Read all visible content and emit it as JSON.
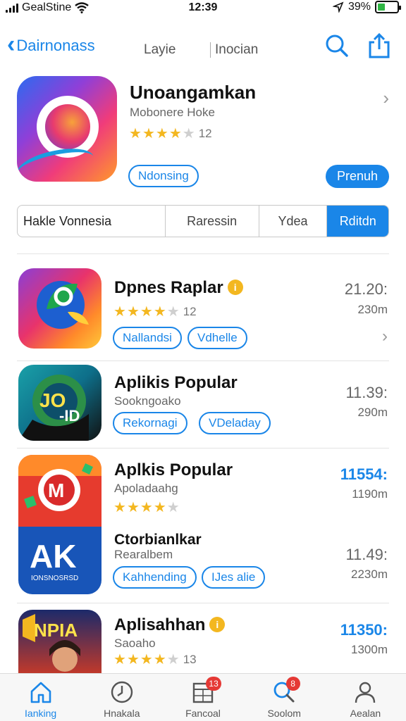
{
  "status": {
    "carrier": "GealStine",
    "time": "12:39",
    "battery": "39%",
    "battery_level": 0.39
  },
  "nav": {
    "back_label": "Dairnonass",
    "tab1": "Layie",
    "tab2": "Inocian"
  },
  "hero": {
    "title": "Unoangamkan",
    "subtitle": "Mobonere Hoke",
    "stars": 4,
    "rating_count": "12",
    "tag": "Ndonsing",
    "action": "Prenuh"
  },
  "segments": [
    "Hakle Vonnesia",
    "Raressin",
    "Ydea",
    "Rditdn"
  ],
  "apps": [
    {
      "name": "Dpnes Raplar",
      "sub": "",
      "stars": 4,
      "rating_count": "12",
      "tags": [
        "Nallandsi",
        "Vdhelle"
      ],
      "time": "21.20:",
      "size": "230m",
      "badge": true
    },
    {
      "name": "Aplikis Popular",
      "sub": "Sookngoako",
      "stars": 0,
      "rating_count": "",
      "tags": [
        "Rekornagi",
        "VDeladay"
      ],
      "time": "11.39:",
      "size": "290m",
      "badge": false
    },
    {
      "name": "Aplkis Popular",
      "sub": "Apoladaahg",
      "stars": 4,
      "rating_count": "",
      "tags": [],
      "time": "11554:",
      "size": "1190m",
      "badge": false
    },
    {
      "name": "Ctorbianlkar",
      "sub": "Rearalbem",
      "stars": 0,
      "rating_count": "",
      "tags": [
        "Kahhending",
        "IJes alie"
      ],
      "time": "11.49:",
      "size": "2230m",
      "badge": false
    },
    {
      "name": "Aplisahhan",
      "sub": "Saoaho",
      "stars": 4,
      "rating_count": "13",
      "tags": [],
      "time": "11350:",
      "size": "1300m",
      "badge": true
    }
  ],
  "icon_texts": {
    "jo": "JO",
    "jo2": "-ID",
    "ak": "AK",
    "ak_sub": "IONSNOSRSD",
    "npia": "NPIA"
  },
  "tabs": [
    {
      "label": "Ianking",
      "icon": "home-icon",
      "badge": ""
    },
    {
      "label": "Hnakala",
      "icon": "clock-icon",
      "badge": ""
    },
    {
      "label": "Fancoal",
      "icon": "calendar-icon",
      "badge": "13"
    },
    {
      "label": "Soolom",
      "icon": "search-icon",
      "badge": "8"
    },
    {
      "label": "Aealan",
      "icon": "person-icon",
      "badge": ""
    }
  ],
  "colors": {
    "accent": "#1a86e8",
    "star": "#f3b720",
    "badge": "#e53935"
  }
}
